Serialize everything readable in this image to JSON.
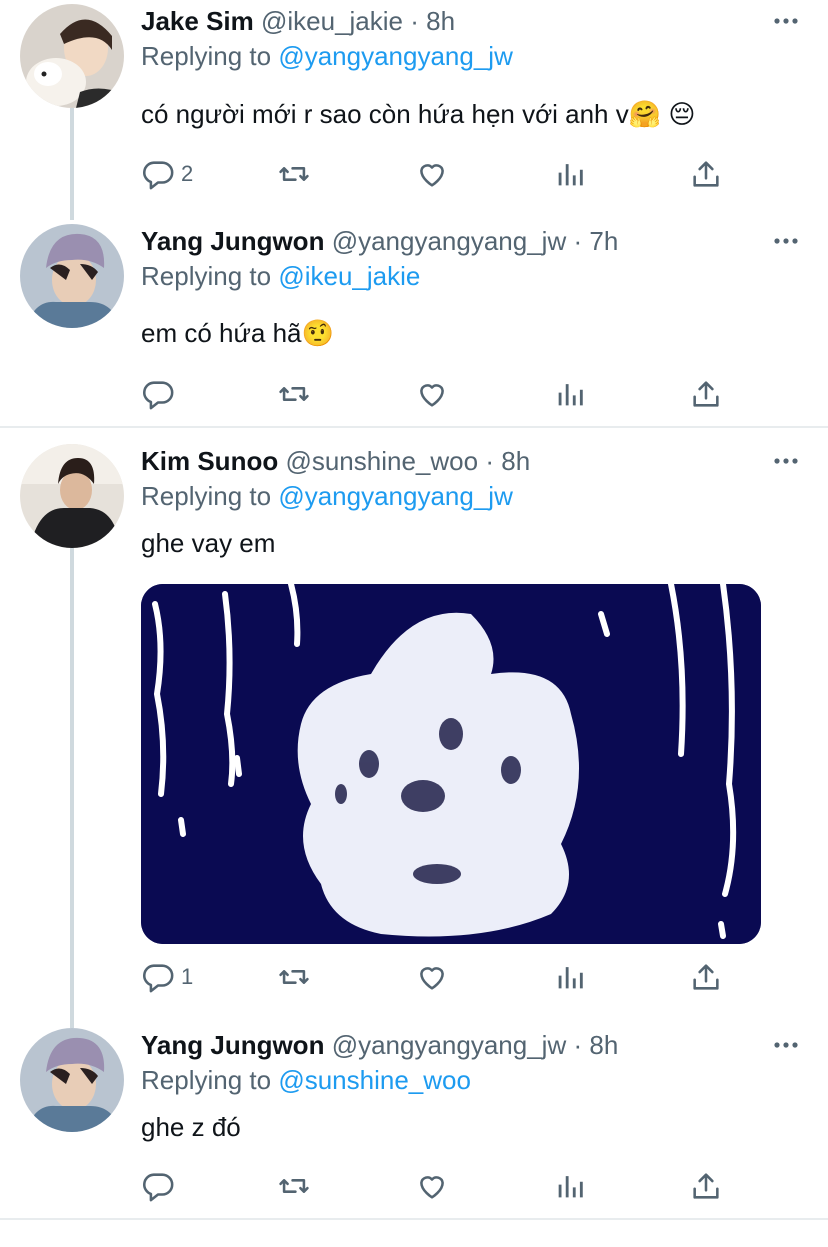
{
  "tweets": [
    {
      "name": "Jake Sim",
      "handle": "@ikeu_jakie",
      "time": "8h",
      "replying_label": "Replying to",
      "replying_to": "@yangyangyang_jw",
      "text": "có người mới r sao còn hứa hẹn với anh v🤗 😔",
      "reply_count": "2"
    },
    {
      "name": "Yang Jungwon",
      "handle": "@yangyangyang_jw",
      "time": "7h",
      "replying_label": "Replying to",
      "replying_to": "@ikeu_jakie",
      "text": "em có hứa hã🤨",
      "reply_count": ""
    },
    {
      "name": "Kim Sunoo",
      "handle": "@sunshine_woo",
      "time": "8h",
      "replying_label": "Replying to",
      "replying_to": "@yangyangyang_jw",
      "text": "ghe vay em",
      "reply_count": "1"
    },
    {
      "name": "Yang Jungwon",
      "handle": "@yangyangyang_jw",
      "time": "8h",
      "replying_label": "Replying to",
      "replying_to": "@sunshine_woo",
      "text": "ghe z đó",
      "reply_count": ""
    }
  ],
  "separator": "·",
  "icons": [
    "reply-icon",
    "retweet-icon",
    "like-icon",
    "analytics-icon",
    "share-icon",
    "more-icon"
  ],
  "colors": {
    "link": "#1d9bf0",
    "muted": "#536471",
    "thread_line": "#cfd9de",
    "media_bg": "#0a0a52"
  }
}
